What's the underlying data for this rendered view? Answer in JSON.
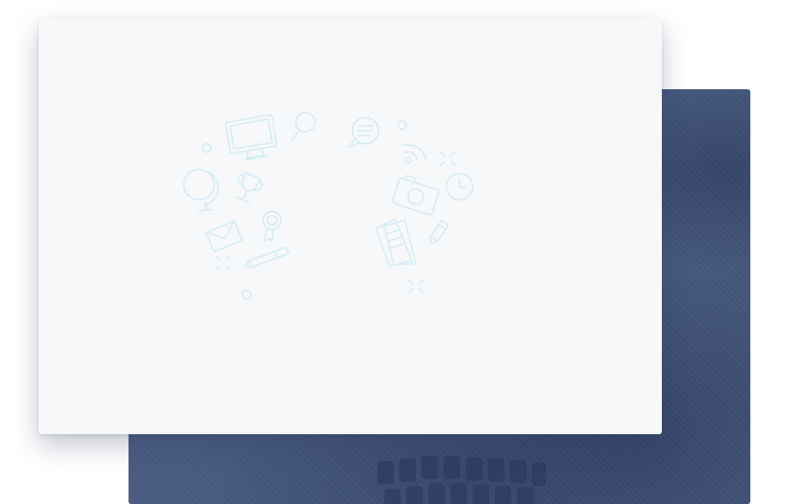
{
  "colors": {
    "page_background": "#ffffff",
    "card_background": "#f7f8f9",
    "panel_blue": "#4a5c80",
    "doodle_stroke": "#d6edf6"
  },
  "illustration": {
    "icons": [
      "monitor-icon",
      "magnifier-icon",
      "globe-icon",
      "trophy-icon",
      "award-ribbon-icon",
      "envelope-icon",
      "pen-icon",
      "speech-bubble-icon",
      "wifi-icon",
      "camera-icon",
      "clock-icon",
      "documents-icon",
      "pencil-icon",
      "sparkle-icon",
      "dot-icon"
    ]
  }
}
